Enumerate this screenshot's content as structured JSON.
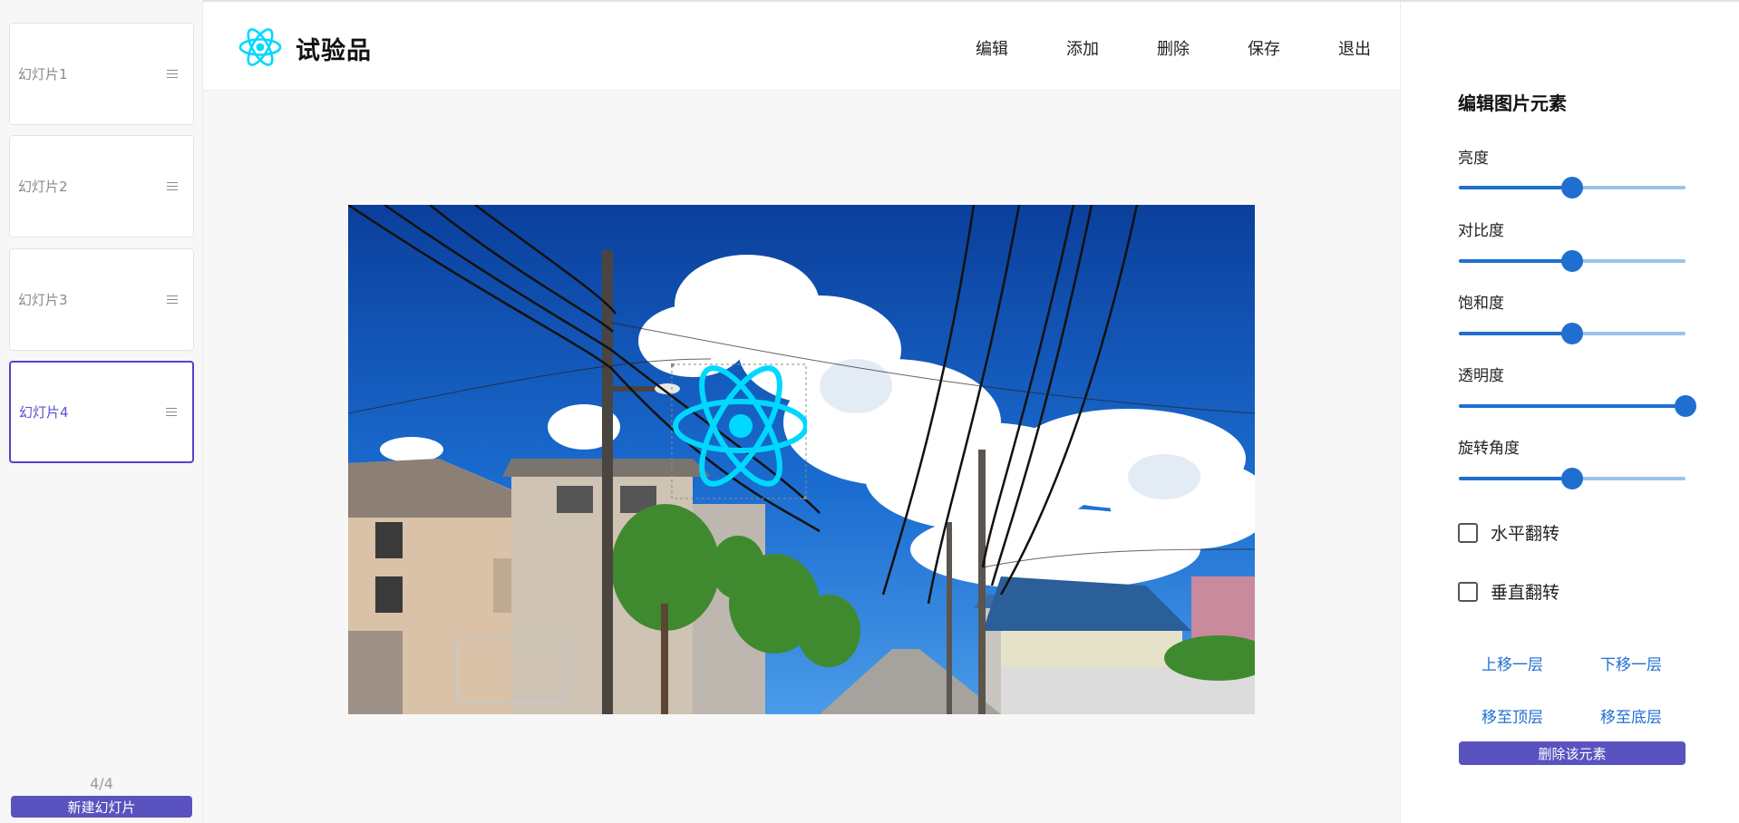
{
  "header": {
    "title": "试验品",
    "nav": [
      "编辑",
      "添加",
      "删除",
      "保存",
      "退出"
    ]
  },
  "sidebar": {
    "slides": [
      {
        "label": "幻灯片1",
        "active": false
      },
      {
        "label": "幻灯片2",
        "active": false
      },
      {
        "label": "幻灯片3",
        "active": false
      },
      {
        "label": "幻灯片4",
        "active": true
      }
    ],
    "count": "4/4",
    "new_slide_label": "新建幻灯片"
  },
  "panel": {
    "title": "编辑图片元素",
    "sliders": [
      {
        "label": "亮度",
        "value": 0.5
      },
      {
        "label": "对比度",
        "value": 0.5
      },
      {
        "label": "饱和度",
        "value": 0.5
      },
      {
        "label": "透明度",
        "value": 1.0
      },
      {
        "label": "旋转角度",
        "value": 0.5
      }
    ],
    "checkboxes": [
      {
        "label": "水平翻转",
        "checked": false
      },
      {
        "label": "垂直翻转",
        "checked": false
      }
    ],
    "layer_buttons": [
      "上移一层",
      "下移一层",
      "移至顶层",
      "移至底层"
    ],
    "delete_label": "删除该元素"
  },
  "colors": {
    "accent": "#5a52bf",
    "slider": "#1f6fd0",
    "react_cyan": "#00d8ff"
  },
  "icons": {
    "logo": "react-atom-icon",
    "drag_handle": "drag-handle-icon"
  }
}
